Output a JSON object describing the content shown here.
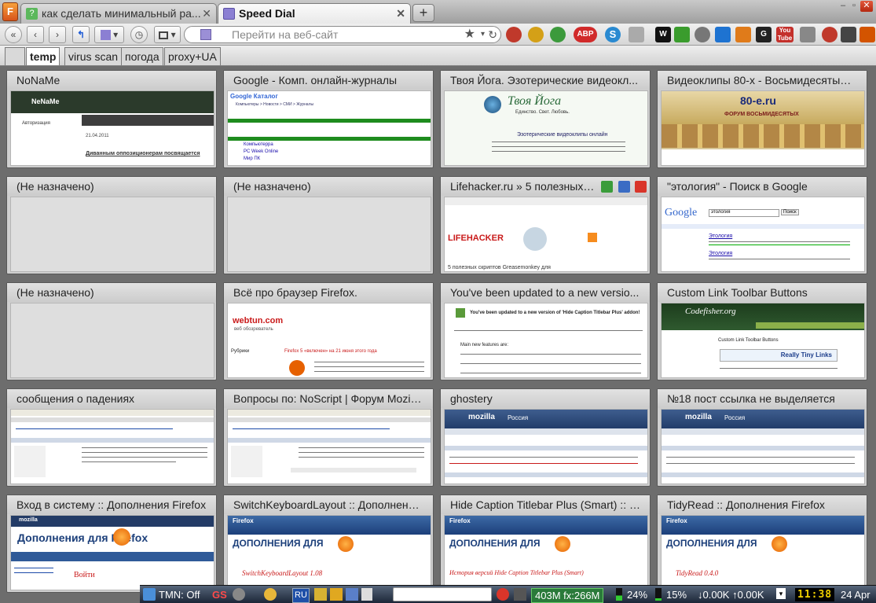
{
  "tabs": [
    {
      "title": "как сделать минимальный ра...",
      "active": false,
      "close": "✕"
    },
    {
      "title": "Speed Dial",
      "active": true,
      "close": "✕"
    }
  ],
  "new_tab_label": "+",
  "window_controls": {
    "minimize": "–",
    "restore": "▫",
    "close": "✕"
  },
  "nav": {
    "url_placeholder": "Перейти на веб-сайт",
    "buttons": [
      "back-all",
      "back",
      "forward",
      "home",
      "speed-dial",
      "history",
      "screenshot"
    ],
    "icon_glyphs": {
      "back_all": "«",
      "back": "‹",
      "forward": "›",
      "home": "↰",
      "history": "◷",
      "star": "★",
      "dropdown": "▾",
      "reload": "↻"
    },
    "addon_labels": {
      "abp": "ABP",
      "skype": "S",
      "w": "W",
      "g": "G",
      "youtube": "You Tube"
    }
  },
  "groups": [
    {
      "label": "temp",
      "active": true
    },
    {
      "label": "virus scan",
      "active": false
    },
    {
      "label": "погода",
      "active": false
    },
    {
      "label": "proxy+UA",
      "active": false
    }
  ],
  "dials": [
    {
      "title": "NoNaMe",
      "kind": "noname"
    },
    {
      "title": "Google - Комп. онлайн-журналы",
      "kind": "google-dir"
    },
    {
      "title": "Твоя Йога. Эзотерические видеокл...",
      "kind": "yoga"
    },
    {
      "title": "Видеоклипы 80-х - Восьмидесятые....",
      "kind": "eighties"
    },
    {
      "title": "(Не назначено)",
      "kind": "empty"
    },
    {
      "title": "(Не назначено)",
      "kind": "empty"
    },
    {
      "title": "Lifehacker.ru » 5 полезных ...",
      "kind": "lifehacker",
      "hover": true
    },
    {
      "title": "\"этология\" - Поиск в Google",
      "kind": "google-search"
    },
    {
      "title": "(Не назначено)",
      "kind": "empty"
    },
    {
      "title": "Всё про браузер Firefox.",
      "kind": "webtun"
    },
    {
      "title": "You've been updated to a new versio...",
      "kind": "update"
    },
    {
      "title": "Custom Link Toolbar Buttons",
      "kind": "codefisher"
    },
    {
      "title": "сообщения о падениях",
      "kind": "forum"
    },
    {
      "title": "Вопросы по: NoScript | Форум Mozill...",
      "kind": "forum"
    },
    {
      "title": "ghostery",
      "kind": "mozilla-forum"
    },
    {
      "title": "№18 пост ссылка не выделяется",
      "kind": "mozilla-forum"
    },
    {
      "title": "Вход в систему :: Дополнения Firefox",
      "kind": "addons-login"
    },
    {
      "title": "SwitchKeyboardLayout :: Дополнени...",
      "kind": "addons"
    },
    {
      "title": "Hide Caption Titlebar Plus (Smart) :: V...",
      "kind": "addons"
    },
    {
      "title": "TidyRead :: Дополнения Firefox",
      "kind": "addons"
    }
  ],
  "thumb_text": {
    "noname_logo": "NeNaMe",
    "noname_date": "21.04.2011",
    "noname_auth": "Авторизация",
    "noname_headline": "Диванным оппозиционерам посвящается",
    "google_dir_logo": "Google Каталог",
    "google_dir_path": "Компьютеры > Новости > СМИ > Журналы",
    "google_dir_items": [
      "Компьютерра",
      "PC Week Online",
      "Мир ПК"
    ],
    "yoga_title": "Твоя Йога",
    "yoga_sub": "Единство. Свет. Любовь.",
    "yoga_heading": "Эзотерические видеоклипы онлайн",
    "eighties_logo": "80-е.ru",
    "eighties_forum": "ФОРУМ ВОСЬМИДЕСЯТЫХ",
    "lh_logo": "LIFEHACKER",
    "lh_footer": "5 полезных скриптов Greasemonkey для",
    "gsearch_logo": "Google",
    "gsearch_query": "этология",
    "gsearch_btn": "Поиск",
    "gsearch_result1": "Этология",
    "gsearch_result2": "Этология",
    "webtun_logo": "webtun.com",
    "webtun_tag": "веб обозреватель",
    "webtun_headline": "Firefox 5 «включен» на 21 июня этого года",
    "webtun_rubric": "Рубрики",
    "update_line": "You've been updated to a new version of 'Hide Caption Titlebar Plus' addon!",
    "update_features": "Main new features are:",
    "codefisher_logo": "Codefisher.org",
    "codefisher_title": "Custom Link Toolbar Buttons",
    "codefisher_sticker": "Really Tiny Links",
    "mozilla_logo": "mozilla",
    "mozilla_russia": "Россия",
    "addons_firefox": "Firefox",
    "addons_header": "ДОПОЛНЕНИЯ ДЛЯ",
    "addons_login_header": "Дополнения для Firefox",
    "addons_login_enter": "Войти",
    "addon_names": [
      "SwitchKeyboardLayout 1.08",
      "История версий Hide Caption Titlebar Plus (Smart)",
      "TidyRead 0.4.0"
    ]
  },
  "taskbar": {
    "tmn": "TMN: Off",
    "gs": "GS",
    "lang": "RU",
    "memory": "403M fx:266M",
    "cpu": "24%",
    "mem2": "15%",
    "net": "↓0.00K ↑0.00K",
    "clock": "11:38",
    "date": "24 Apr"
  },
  "colors": {
    "accent": "#2e5fa3",
    "firefox_orange": "#e66000",
    "google_green": "#13a10e"
  }
}
